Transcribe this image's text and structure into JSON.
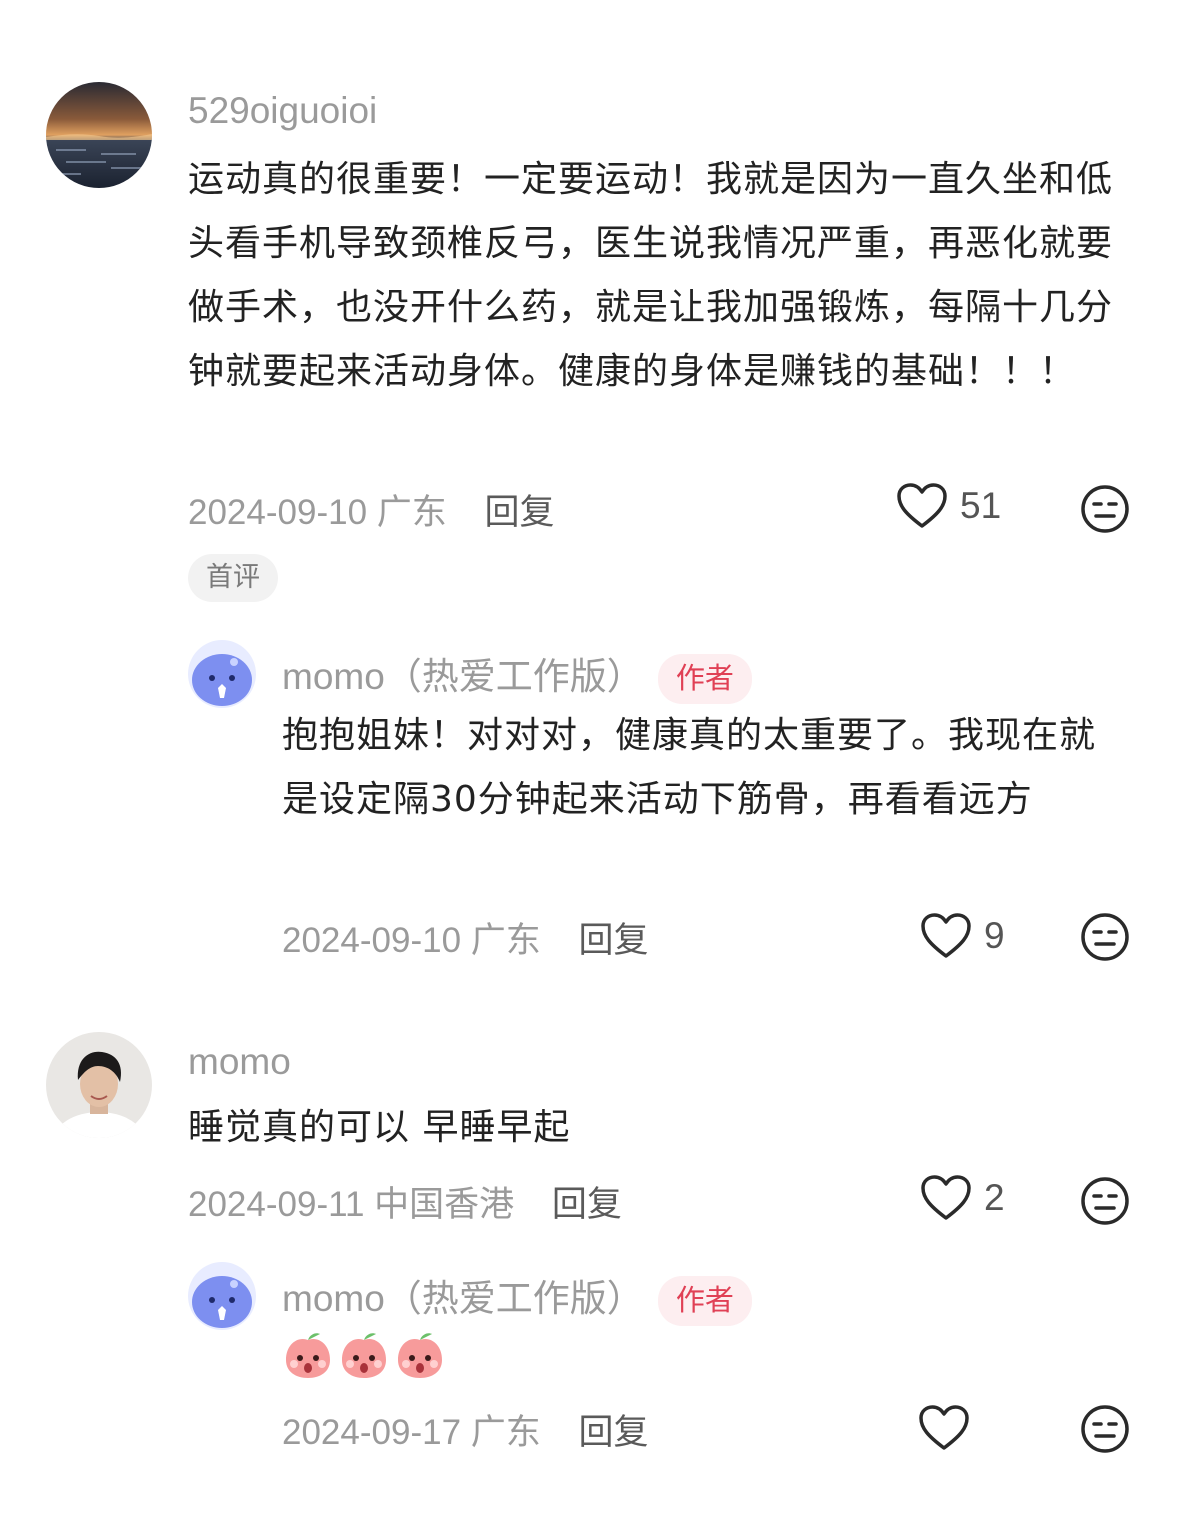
{
  "comments": [
    {
      "username": "529oiguoioi",
      "text": "运动真的很重要！一定要运动！我就是因为一直久坐和低头看手机导致颈椎反弓，医生说我情况严重，再恶化就要做手术，也没开什么药，就是让我加强锻炼，每隔十几分钟就要起来活动身体。健康的身体是赚钱的基础！！！",
      "date": "2024-09-10",
      "location": "广东",
      "reply_label": "回复",
      "likes": "51",
      "tag": "首评",
      "avatar_icon": "sunset-sea-icon",
      "replies": [
        {
          "username": "momo（热爱工作版）",
          "badge": "作者",
          "text": "抱抱姐妹！对对对，健康真的太重要了。我现在就是设定隔30分钟起来活动下筋骨，再看看远方",
          "date": "2024-09-10",
          "location": "广东",
          "reply_label": "回复",
          "likes": "9",
          "avatar_icon": "cartoon-whale-icon"
        }
      ]
    },
    {
      "username": "momo",
      "text": "睡觉真的可以 早睡早起",
      "date": "2024-09-11",
      "location": "中国香港",
      "reply_label": "回复",
      "likes": "2",
      "avatar_icon": "woman-portrait-icon",
      "replies": [
        {
          "username": "momo（热爱工作版）",
          "badge": "作者",
          "text": "",
          "stickers": [
            "peach-emoji-icon",
            "peach-emoji-icon",
            "peach-emoji-icon"
          ],
          "date": "2024-09-17",
          "location": "广东",
          "reply_label": "回复",
          "likes": "",
          "avatar_icon": "cartoon-whale-icon"
        }
      ]
    }
  ],
  "colors": {
    "meta_gray": "#9a9a9a",
    "author_badge_bg": "#fdeef0",
    "author_badge_text": "#e04055",
    "tag_bg": "#f2f2f2"
  }
}
